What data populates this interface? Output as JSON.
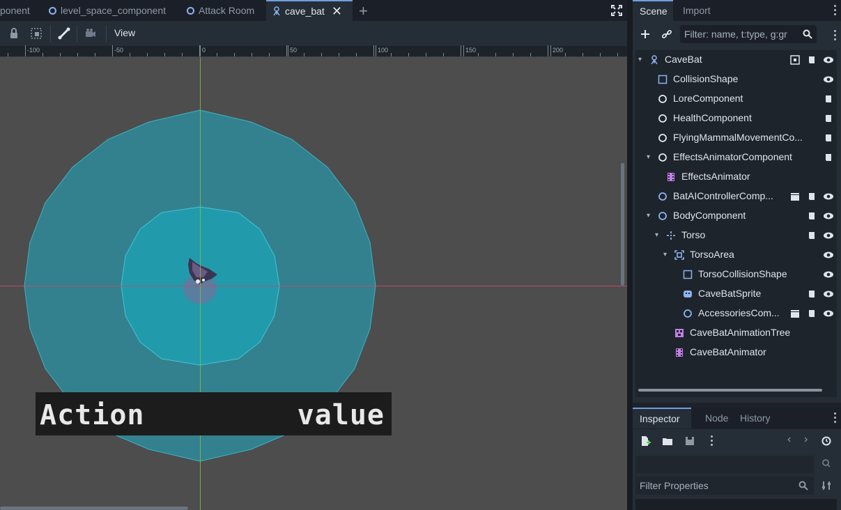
{
  "editor_tabs": [
    {
      "label": "ponent"
    },
    {
      "label": "level_space_component"
    },
    {
      "label": "Attack Room"
    },
    {
      "label": "cave_bat"
    }
  ],
  "toolbar": {
    "view_label": "View"
  },
  "ruler": {
    "labels": [
      "-100",
      "-50",
      "0",
      "50",
      "100",
      "150",
      "200"
    ]
  },
  "viewport": {
    "action_label": "Action",
    "value_label": "value",
    "colors": {
      "background": "#4d4d4d",
      "outer_circle": "#2a8fa0",
      "inner_circle": "#19a3b4",
      "axis_x": "#c84a6a",
      "axis_y": "#8fbf3a"
    }
  },
  "scene_dock": {
    "tabs": [
      "Scene",
      "Import"
    ],
    "filter_placeholder": "Filter: name, t:type, g:gr",
    "nodes": [
      {
        "label": "CaveBat",
        "icon": "bat-node-icon",
        "icons": [
          "pin-icon",
          "script-icon",
          "eye-icon"
        ]
      },
      {
        "label": "CollisionShape",
        "icon": "collision-shape-icon",
        "icons": [
          "eye-icon"
        ]
      },
      {
        "label": "LoreComponent",
        "icon": "node-circle-icon",
        "icons": [
          "script-icon"
        ]
      },
      {
        "label": "HealthComponent",
        "icon": "node-circle-icon",
        "icons": [
          "script-icon"
        ]
      },
      {
        "label": "FlyingMammalMovementCo...",
        "icon": "node-circle-icon",
        "icons": [
          "script-icon"
        ]
      },
      {
        "label": "EffectsAnimatorComponent",
        "icon": "node-circle-icon",
        "icons": [
          "script-icon"
        ]
      },
      {
        "label": "EffectsAnimator",
        "icon": "animation-player-icon",
        "icons": []
      },
      {
        "label": "BatAIControllerComp...",
        "icon": "node2d-circle-icon",
        "icons": [
          "clapper-icon",
          "script-icon",
          "eye-icon"
        ]
      },
      {
        "label": "BodyComponent",
        "icon": "node2d-circle-icon",
        "icons": [
          "script-icon",
          "eye-icon"
        ]
      },
      {
        "label": "Torso",
        "icon": "marker-icon",
        "icons": [
          "script-icon",
          "eye-icon"
        ]
      },
      {
        "label": "TorsoArea",
        "icon": "area-icon",
        "icons": [
          "eye-icon"
        ]
      },
      {
        "label": "TorsoCollisionShape",
        "icon": "collision-shape-icon",
        "icons": [
          "eye-icon"
        ]
      },
      {
        "label": "CaveBatSprite",
        "icon": "sprite-icon",
        "icons": [
          "script-icon",
          "eye-icon"
        ]
      },
      {
        "label": "AccessoriesCom...",
        "icon": "node2d-circle-icon",
        "icons": [
          "clapper-icon",
          "script-icon",
          "eye-icon"
        ]
      },
      {
        "label": "CaveBatAnimationTree",
        "icon": "animation-tree-icon",
        "icons": []
      },
      {
        "label": "CaveBatAnimator",
        "icon": "animation-player-icon",
        "icons": []
      }
    ]
  },
  "inspector_dock": {
    "tabs": [
      "Inspector",
      "Node",
      "History"
    ],
    "filter_placeholder": "Filter Properties"
  }
}
